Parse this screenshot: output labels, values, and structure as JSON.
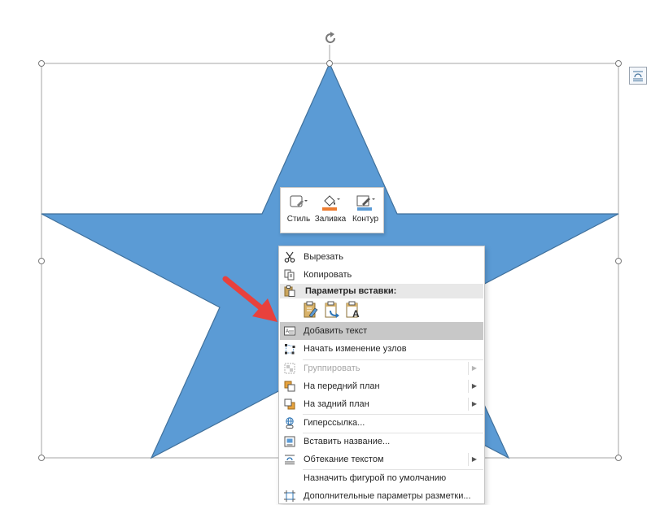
{
  "mini_toolbar": {
    "buttons": [
      {
        "label": "Стиль",
        "icon": "shape-style-icon"
      },
      {
        "label": "Заливка",
        "icon": "paint-bucket-icon",
        "color": "#ED7D31"
      },
      {
        "label": "Контур",
        "icon": "outline-pen-icon",
        "color": "#5B9BD5"
      }
    ]
  },
  "context_menu": {
    "items": [
      {
        "label": "Вырезать",
        "icon": "scissors-icon",
        "enabled": true
      },
      {
        "label": "Копировать",
        "icon": "copy-icon",
        "enabled": true
      },
      {
        "label": "Параметры вставки:",
        "icon": "paste-icon",
        "section_header": true
      },
      {
        "label": "Добавить текст",
        "icon": "text-box-icon",
        "enabled": true,
        "highlighted": true
      },
      {
        "label": "Начать изменение узлов",
        "icon": "edit-points-icon",
        "enabled": true
      },
      {
        "label": "Группировать",
        "icon": "group-icon",
        "enabled": false,
        "submenu": true
      },
      {
        "label": "На передний план",
        "icon": "bring-forward-icon",
        "enabled": true,
        "submenu": true
      },
      {
        "label": "На задний план",
        "icon": "send-backward-icon",
        "enabled": true,
        "submenu": true
      },
      {
        "label": "Гиперссылка...",
        "icon": "hyperlink-icon",
        "enabled": true
      },
      {
        "label": "Вставить название...",
        "icon": "caption-icon",
        "enabled": true
      },
      {
        "label": "Обтекание текстом",
        "icon": "wrap-text-icon",
        "enabled": true,
        "submenu": true
      },
      {
        "label": "Назначить фигурой по умолчанию",
        "icon": "",
        "enabled": true
      },
      {
        "label": "Дополнительные параметры разметки...",
        "icon": "layout-options-icon",
        "enabled": true
      }
    ],
    "paste_options": [
      "paste-keep-formatting-icon",
      "paste-merge-icon",
      "paste-text-only-icon"
    ]
  },
  "colors": {
    "star_fill": "#5B9BD5",
    "star_stroke": "#41719C",
    "arrow": "#E8413D",
    "highlight": "#C8C8C8",
    "selection_border": "#A6A6A6"
  }
}
